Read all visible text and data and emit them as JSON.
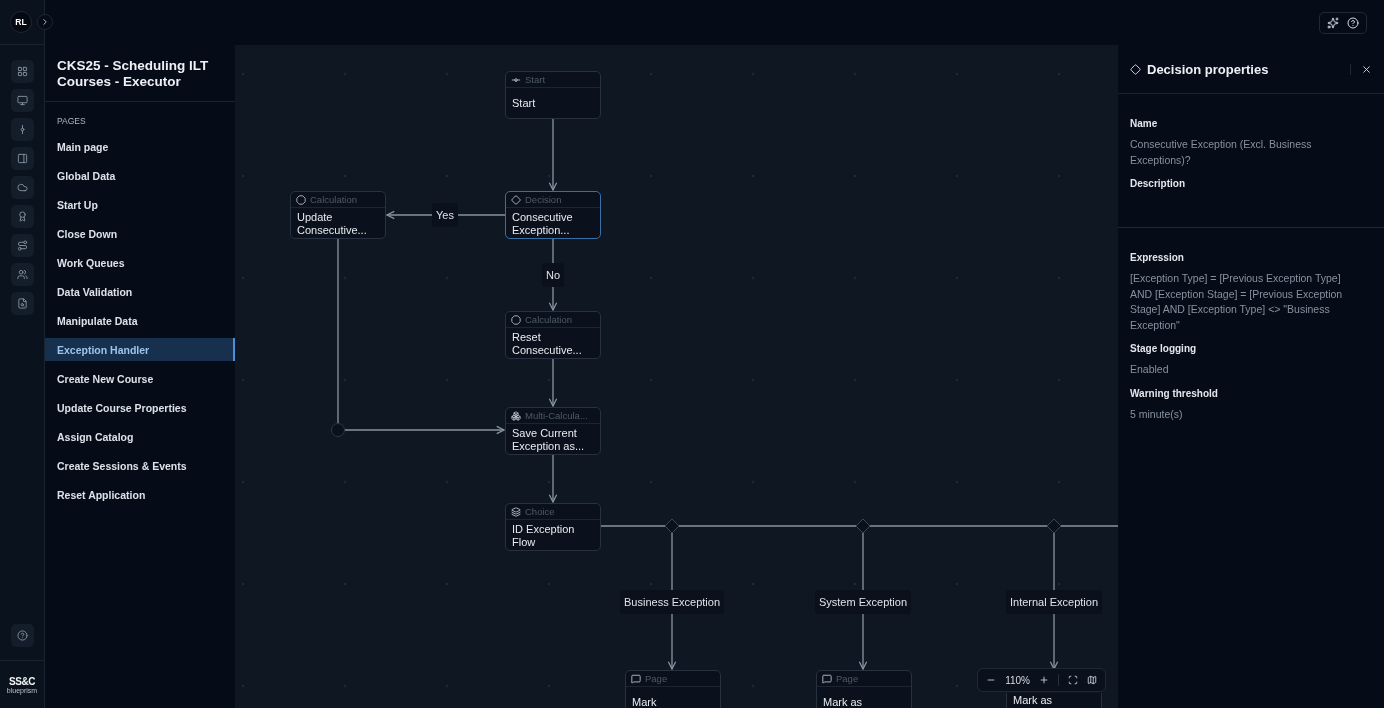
{
  "header": {
    "avatar": "RL"
  },
  "rail": {
    "logo": {
      "mark": "SS&C",
      "sub": "blueprism"
    }
  },
  "sidebar": {
    "title": "CKS25 - Scheduling ILT Courses - Executor",
    "section": "PAGES",
    "items": [
      {
        "label": "Main page",
        "selected": false
      },
      {
        "label": "Global Data",
        "selected": false
      },
      {
        "label": "Start Up",
        "selected": false
      },
      {
        "label": "Close Down",
        "selected": false
      },
      {
        "label": "Work Queues",
        "selected": false
      },
      {
        "label": "Data Validation",
        "selected": false
      },
      {
        "label": "Manipulate Data",
        "selected": false
      },
      {
        "label": "Exception Handler",
        "selected": true
      },
      {
        "label": "Create New Course",
        "selected": false
      },
      {
        "label": "Update Course Properties",
        "selected": false
      },
      {
        "label": "Assign Catalog",
        "selected": false
      },
      {
        "label": "Create Sessions & Events",
        "selected": false
      },
      {
        "label": "Reset Application",
        "selected": false
      }
    ]
  },
  "canvas": {
    "nodes": [
      {
        "kind": "start",
        "header": "Start",
        "title": "Start",
        "selected": false
      },
      {
        "kind": "calculation",
        "header": "Calculation",
        "title": "Update Consecutive...",
        "selected": false
      },
      {
        "kind": "decision",
        "header": "Decision",
        "title": "Consecutive Exception...",
        "selected": true
      },
      {
        "kind": "calculation",
        "header": "Calculation",
        "title": "Reset Consecutive...",
        "selected": false
      },
      {
        "kind": "multi",
        "header": "Multi-Calcula...",
        "title": "Save Current Exception as...",
        "selected": false
      },
      {
        "kind": "choice",
        "header": "Choice",
        "title": "ID Exception Flow",
        "selected": false
      },
      {
        "kind": "page",
        "header": "Page",
        "title": "Mark",
        "selected": false
      },
      {
        "kind": "page",
        "header": "Page",
        "title": "Mark as",
        "selected": false
      },
      {
        "kind": "page",
        "title": "Mark as",
        "selected": false
      }
    ],
    "edge_labels": [
      "Yes",
      "No",
      "Business Exception",
      "System Exception",
      "Internal Exception"
    ],
    "zoom_label": "110%"
  },
  "panel": {
    "title": "Decision properties",
    "sections": [
      {
        "fields": [
          {
            "label": "Name",
            "value": "Consecutive Exception (Excl. Business Exceptions)?"
          },
          {
            "label": "Description"
          }
        ]
      },
      {
        "fields": [
          {
            "label": "Expression",
            "value": "[Exception Type] = [Previous Exception Type] AND [Exception Stage] = [Previous Exception Stage] AND [Exception Type] <> \"Business Exception\""
          },
          {
            "label": "Stage logging",
            "value": "Enabled"
          },
          {
            "label": "Warning threshold",
            "value": "5 minute(s)"
          }
        ]
      }
    ]
  }
}
